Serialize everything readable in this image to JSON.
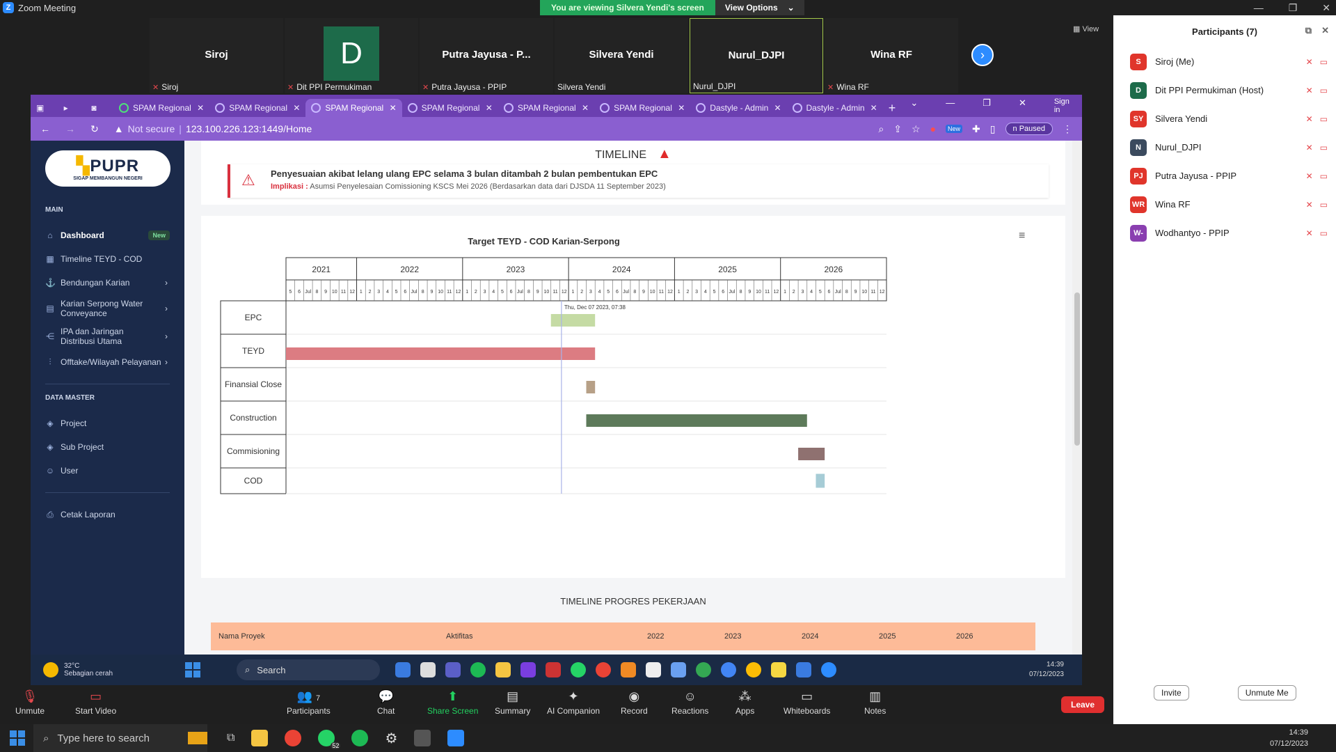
{
  "zoom": {
    "window_title": "Zoom Meeting",
    "banner_text": "You are viewing Silvera Yendi's screen",
    "view_options": "View Options",
    "view_label": "View",
    "sign_in": "Sign in",
    "tiles": [
      {
        "name": "Siroj",
        "label": "Siroj",
        "muted": true
      },
      {
        "name": "D",
        "label": "Dit PPI Permukiman",
        "muted": true
      },
      {
        "name": "Putra Jayusa - P...",
        "label": "Putra Jayusa - PPIP",
        "muted": true
      },
      {
        "name": "Silvera Yendi",
        "label": "Silvera Yendi",
        "muted": false
      },
      {
        "name": "Nurul_DJPI",
        "label": "Nurul_DJPI",
        "muted": false
      },
      {
        "name": "Wina RF",
        "label": "Wina RF",
        "muted": true
      }
    ],
    "controls": {
      "unmute": "Unmute",
      "start_video": "Start Video",
      "participants": "Participants",
      "participants_count": "7",
      "chat": "Chat",
      "share_screen": "Share Screen",
      "summary": "Summary",
      "ai_companion": "AI Companion",
      "record": "Record",
      "reactions": "Reactions",
      "apps": "Apps",
      "whiteboards": "Whiteboards",
      "notes": "Notes",
      "leave": "Leave"
    }
  },
  "participants_panel": {
    "title": "Participants (7)",
    "invite": "Invite",
    "unmute_me": "Unmute Me",
    "list": [
      {
        "initials": "S",
        "name": "Siroj (Me)",
        "color": "#e0352b"
      },
      {
        "initials": "D",
        "name": "Dit PPI Permukiman (Host)",
        "color": "#1d6b4a"
      },
      {
        "initials": "SY",
        "name": "Silvera Yendi",
        "color": "#e0352b"
      },
      {
        "initials": "N",
        "name": "Nurul_DJPI",
        "color": "#3b4a5e"
      },
      {
        "initials": "PJ",
        "name": "Putra Jayusa - PPIP",
        "color": "#e0352b"
      },
      {
        "initials": "WR",
        "name": "Wina RF",
        "color": "#e0352b"
      },
      {
        "initials": "W-",
        "name": "Wodhantyo - PPIP",
        "color": "#8a3fb0"
      }
    ]
  },
  "browser": {
    "tabs": [
      "SPAM Regional",
      "SPAM Regional",
      "SPAM Regional",
      "SPAM Regional",
      "SPAM Regional",
      "SPAM Regional",
      "Dastyle - Admin",
      "Dastyle - Admin"
    ],
    "not_secure": "Not secure",
    "url": "123.100.226.123:1449/Home",
    "paused": "Paused",
    "new_badge": "New"
  },
  "app": {
    "logo_text": "PUPR",
    "logo_tagline": "SIGAP MEMBANGUN NEGERI",
    "section_main": "MAIN",
    "section_master": "DATA MASTER",
    "nav_main": [
      {
        "label": "Dashboard",
        "badge": "New"
      },
      {
        "label": "Timeline TEYD - COD"
      },
      {
        "label": "Bendungan Karian"
      },
      {
        "label": "Karian Serpong Water Conveyance"
      },
      {
        "label": "IPA dan Jaringan Distribusi Utama"
      },
      {
        "label": "Offtake/Wilayah Pelayanan"
      }
    ],
    "nav_master": [
      {
        "label": "Project"
      },
      {
        "label": "Sub Project"
      },
      {
        "label": "User"
      }
    ],
    "nav_report": {
      "label": "Cetak Laporan"
    },
    "timeline_title": "TIMELINE",
    "alert_title": "Penyesuaian akibat lelang ulang EPC selama 3 bulan ditambah 2 bulan pembentukan EPC",
    "alert_impl_label": "Implikasi :",
    "alert_impl_text": "Asumsi Penyelesaian Comissioning KSCS Mei 2026 (Berdasarkan data dari DJSDA 11 September 2023)",
    "progress_title": "TIMELINE PROGRES PEKERJAAN",
    "progress_headers": [
      "Nama Proyek",
      "Aktifitas",
      "2022",
      "2023",
      "2024",
      "2025",
      "2026"
    ]
  },
  "chart_data": {
    "type": "gantt",
    "title": "Target TEYD - COD Karian-Serpong",
    "years": [
      "2021",
      "2022",
      "2023",
      "2024",
      "2025",
      "2026"
    ],
    "months_2021": [
      "5",
      "6",
      "Jul",
      "8",
      "9",
      "10",
      "11",
      "12"
    ],
    "months_full": [
      "1",
      "2",
      "3",
      "4",
      "5",
      "6",
      "Jul",
      "8",
      "9",
      "10",
      "11",
      "12"
    ],
    "current_date_label": "Thu, Dec 07 2023, 07:38",
    "current_date": "2023-12-07",
    "tasks": [
      {
        "name": "EPC",
        "start": "2023-11",
        "end": "2024-03",
        "color": "#c5dba4"
      },
      {
        "name": "TEYD",
        "start": "2021-05",
        "end": "2024-03",
        "color": "#dc7c82"
      },
      {
        "name": "Finansial Close",
        "start": "2024-03",
        "end": "2024-03",
        "color": "#b7a087"
      },
      {
        "name": "Construction",
        "start": "2024-03",
        "end": "2026-03",
        "color": "#5d7a5a"
      },
      {
        "name": "Commisioning",
        "start": "2026-03",
        "end": "2026-05",
        "color": "#8f7170"
      },
      {
        "name": "COD",
        "start": "2026-05",
        "end": "2026-05",
        "color": "#a6ccd6"
      }
    ]
  },
  "win_inner": {
    "weather_temp": "32°C",
    "weather_desc": "Sebagian cerah",
    "search": "Search",
    "time": "14:39",
    "date": "07/12/2023"
  },
  "win_outer": {
    "search_placeholder": "Type here to search",
    "time": "14:39",
    "date": "07/12/2023",
    "whatsapp_badge": "52"
  }
}
